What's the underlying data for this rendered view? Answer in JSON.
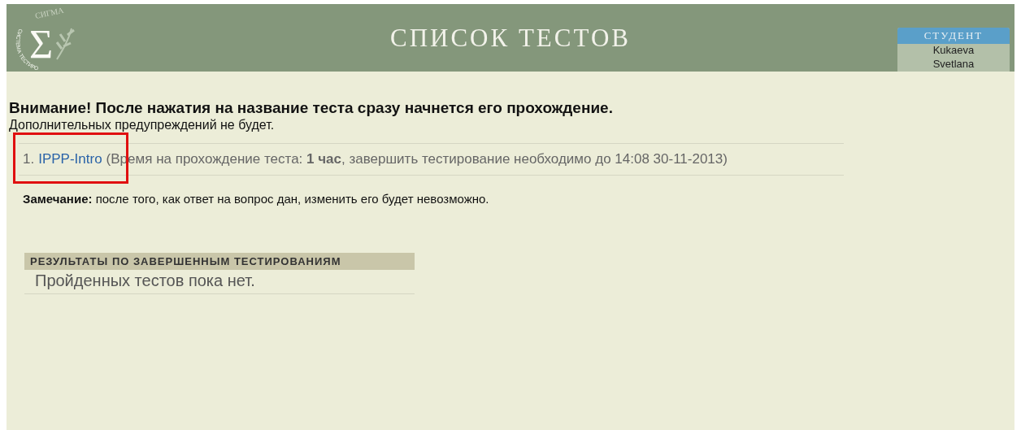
{
  "header": {
    "logo": {
      "symbol": "Σ",
      "top_text": "СИГМА",
      "ring_text": "СИСТЕМА ТЕСТИРО"
    },
    "title": "СПИСОК ТЕСТОВ",
    "user": {
      "role": "СТУДЕНТ",
      "name_lines": [
        "Kukaeva",
        "Svetlana"
      ]
    }
  },
  "warning": {
    "title": "Внимание! После нажатия на название теста сразу начнется его прохождение.",
    "subtitle": "Дополнительных предупреждений не будет."
  },
  "tests": [
    {
      "number": "1.",
      "name": "IPPP-Intro",
      "highlighted": true,
      "details": "(Время на прохождение теста: **1 час**, завершить тестирование необходимо до 14:08 30-11-2013)"
    }
  ],
  "note": "**Замечание:** после того, как ответ на вопрос дан, изменить его будет невозможно.",
  "results": {
    "heading": "РЕЗУЛЬТАТЫ ПО ЗАВЕРШЕННЫМ ТЕСТИРОВАНИЯМ",
    "empty_text": "Пройденных тестов пока нет."
  }
}
